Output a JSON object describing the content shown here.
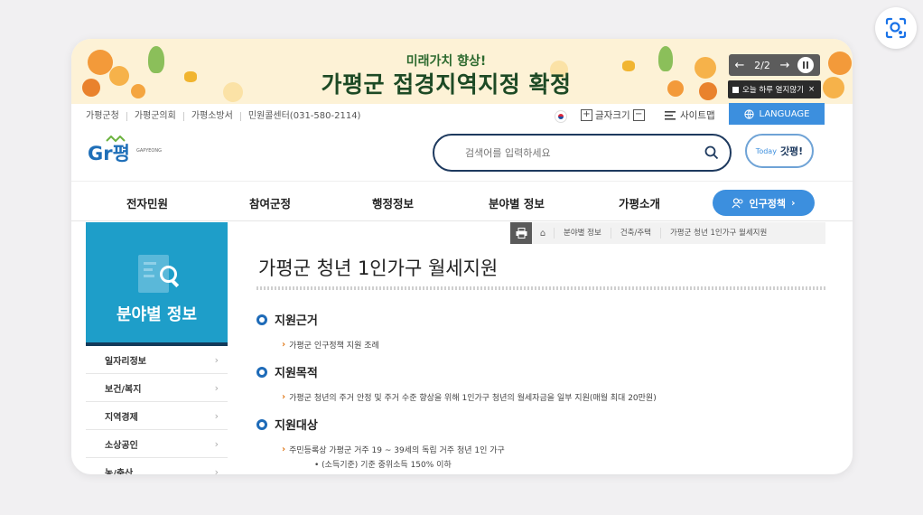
{
  "banner": {
    "subtitle": "미래가치 향상!",
    "title": "가평군 접경지역지정 확정",
    "slide_counter": "2/2",
    "prev_label": "←",
    "next_label": "→",
    "dont_show_today": "오늘 하루 열지않기",
    "close_x": "×"
  },
  "utility": {
    "links": [
      "가평군청",
      "가평군의회",
      "가평소방서",
      "민원콜센터(031-580-2114)"
    ],
    "font_size_label": "글자크기",
    "font_plus": "+",
    "font_minus": "−",
    "sitemap_label": "사이트맵",
    "language_label": "LANGUAGE"
  },
  "header": {
    "logo_text": "Gr평",
    "logo_sub": "GAPYEONG",
    "search_placeholder": "검색어를 입력하세요",
    "today_label": "Today",
    "today_brand": "갓평!"
  },
  "nav": {
    "items": [
      "전자민원",
      "참여군정",
      "행정정보",
      "분야별 정보",
      "가평소개"
    ],
    "population_button": "인구정책"
  },
  "sidebar": {
    "title": "분야별 정보",
    "items": [
      "일자리정보",
      "보건/복지",
      "지역경제",
      "소상공인",
      "농/축산"
    ]
  },
  "breadcrumb": [
    "분야별 정보",
    "건축/주택",
    "가평군 청년 1인가구 월세지원"
  ],
  "main": {
    "title": "가평군 청년 1인가구 월세지원",
    "sections": [
      {
        "heading": "지원근거",
        "line": "가평군 인구정책 지원 조례"
      },
      {
        "heading": "지원목적",
        "line": "가평군 청년의 주거 안정 및 주거 수준 향상을 위해 1인가구 청년의 월세자금을 일부 지원(매월 최대 20만원)"
      },
      {
        "heading": "지원대상",
        "line": "주민등록상 가평군 거주 19 ~ 39세의 독립 거주 청년 1인 가구",
        "sub": "(소득기준) 기준 중위소득 150% 이하"
      }
    ]
  },
  "colors": {
    "accent_blue": "#3c8fde",
    "sidebar_blue": "#1e9ec9",
    "navy": "#1e3a5f",
    "banner_bg": "#fdf2d6",
    "bullet_blue": "#1e6bb8",
    "arrow_orange": "#e07a1c"
  }
}
